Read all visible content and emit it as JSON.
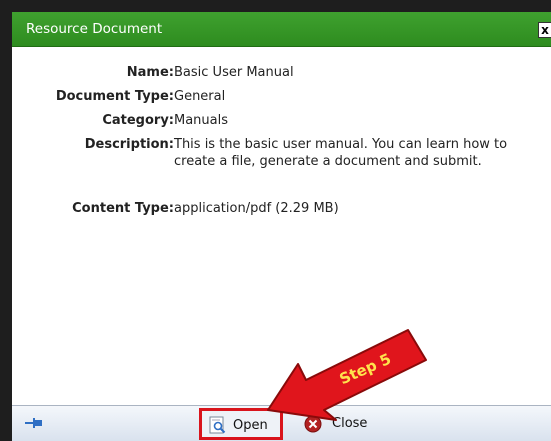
{
  "dialog": {
    "title": "Resource Document",
    "close_glyph": "x"
  },
  "fields": [
    {
      "label": "Name:",
      "value": "Basic User Manual"
    },
    {
      "label": "Document Type:",
      "value": "General"
    },
    {
      "label": "Category:",
      "value": "Manuals"
    },
    {
      "label": "Description:",
      "value": "This is the basic user manual. You can learn how to create a file, generate a document and submit."
    },
    {
      "label": "Content Type:",
      "value": "application/pdf (2.29 MB)"
    }
  ],
  "footer": {
    "open_label": "Open",
    "close_label": "Close",
    "open_icon": "document-preview-icon",
    "close_icon": "close-circle-icon",
    "pin_icon": "pin-icon"
  },
  "annotation": {
    "step_label": "Step 5"
  },
  "colors": {
    "titlebar": "#3fa12f",
    "highlight": "#d9141c",
    "arrow": "#e0151c",
    "annotation_text": "#ffe34d"
  }
}
